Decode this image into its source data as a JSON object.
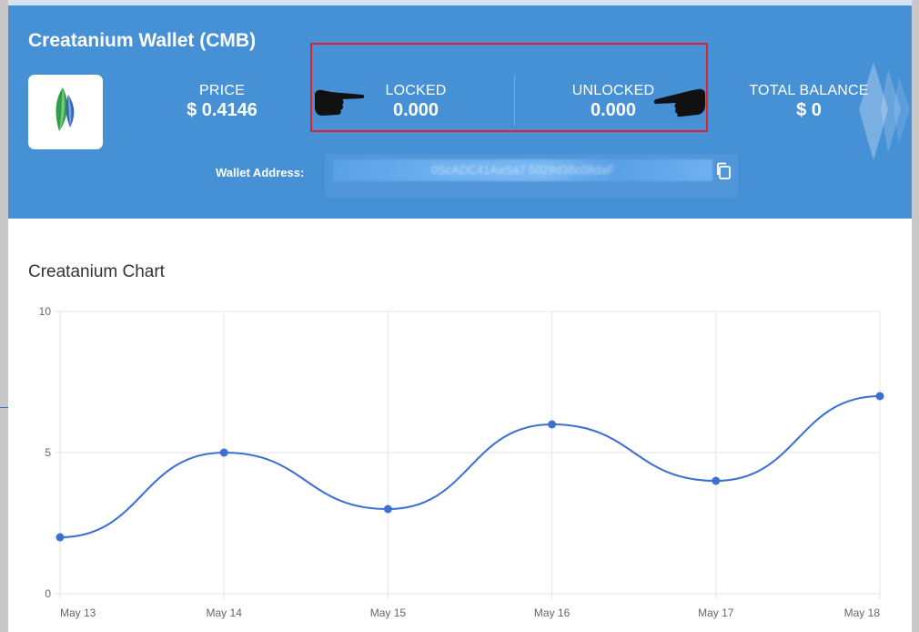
{
  "wallet": {
    "title": "Creatanium Wallet (CMB)",
    "logo_icon": "creatanium-leaf-icon",
    "stats": {
      "price": {
        "label": "PRICE",
        "value": "$ 0.4146"
      },
      "locked": {
        "label": "LOCKED",
        "value": "0.000"
      },
      "unlocked": {
        "label": "UNLOCKED",
        "value": "0.000"
      },
      "total": {
        "label": "TOTAL BALANCE",
        "value": "$ 0"
      }
    },
    "address_label": "Wallet Address:",
    "address_value": "0ScADC41AaSa7        5029d38c08daF",
    "copy_icon": "copy-icon"
  },
  "annotations": {
    "highlight_color": "#e0202b",
    "pointers": [
      "pointing-hand-right-icon",
      "pointing-hand-left-icon"
    ]
  },
  "colors": {
    "header_bg": "#4690d6",
    "line": "#3b6fd4"
  },
  "chart": {
    "title": "Creatanium Chart"
  },
  "chart_data": {
    "type": "line",
    "title": "Creatanium Chart",
    "categories": [
      "May 13",
      "May 14",
      "May 15",
      "May 16",
      "May 17",
      "May 18"
    ],
    "series": [
      {
        "values": [
          2,
          5,
          3,
          6,
          4,
          7
        ]
      }
    ],
    "y_ticks": [
      0,
      5,
      10
    ],
    "ylim": [
      0,
      10
    ],
    "grid": true,
    "smooth": true
  }
}
